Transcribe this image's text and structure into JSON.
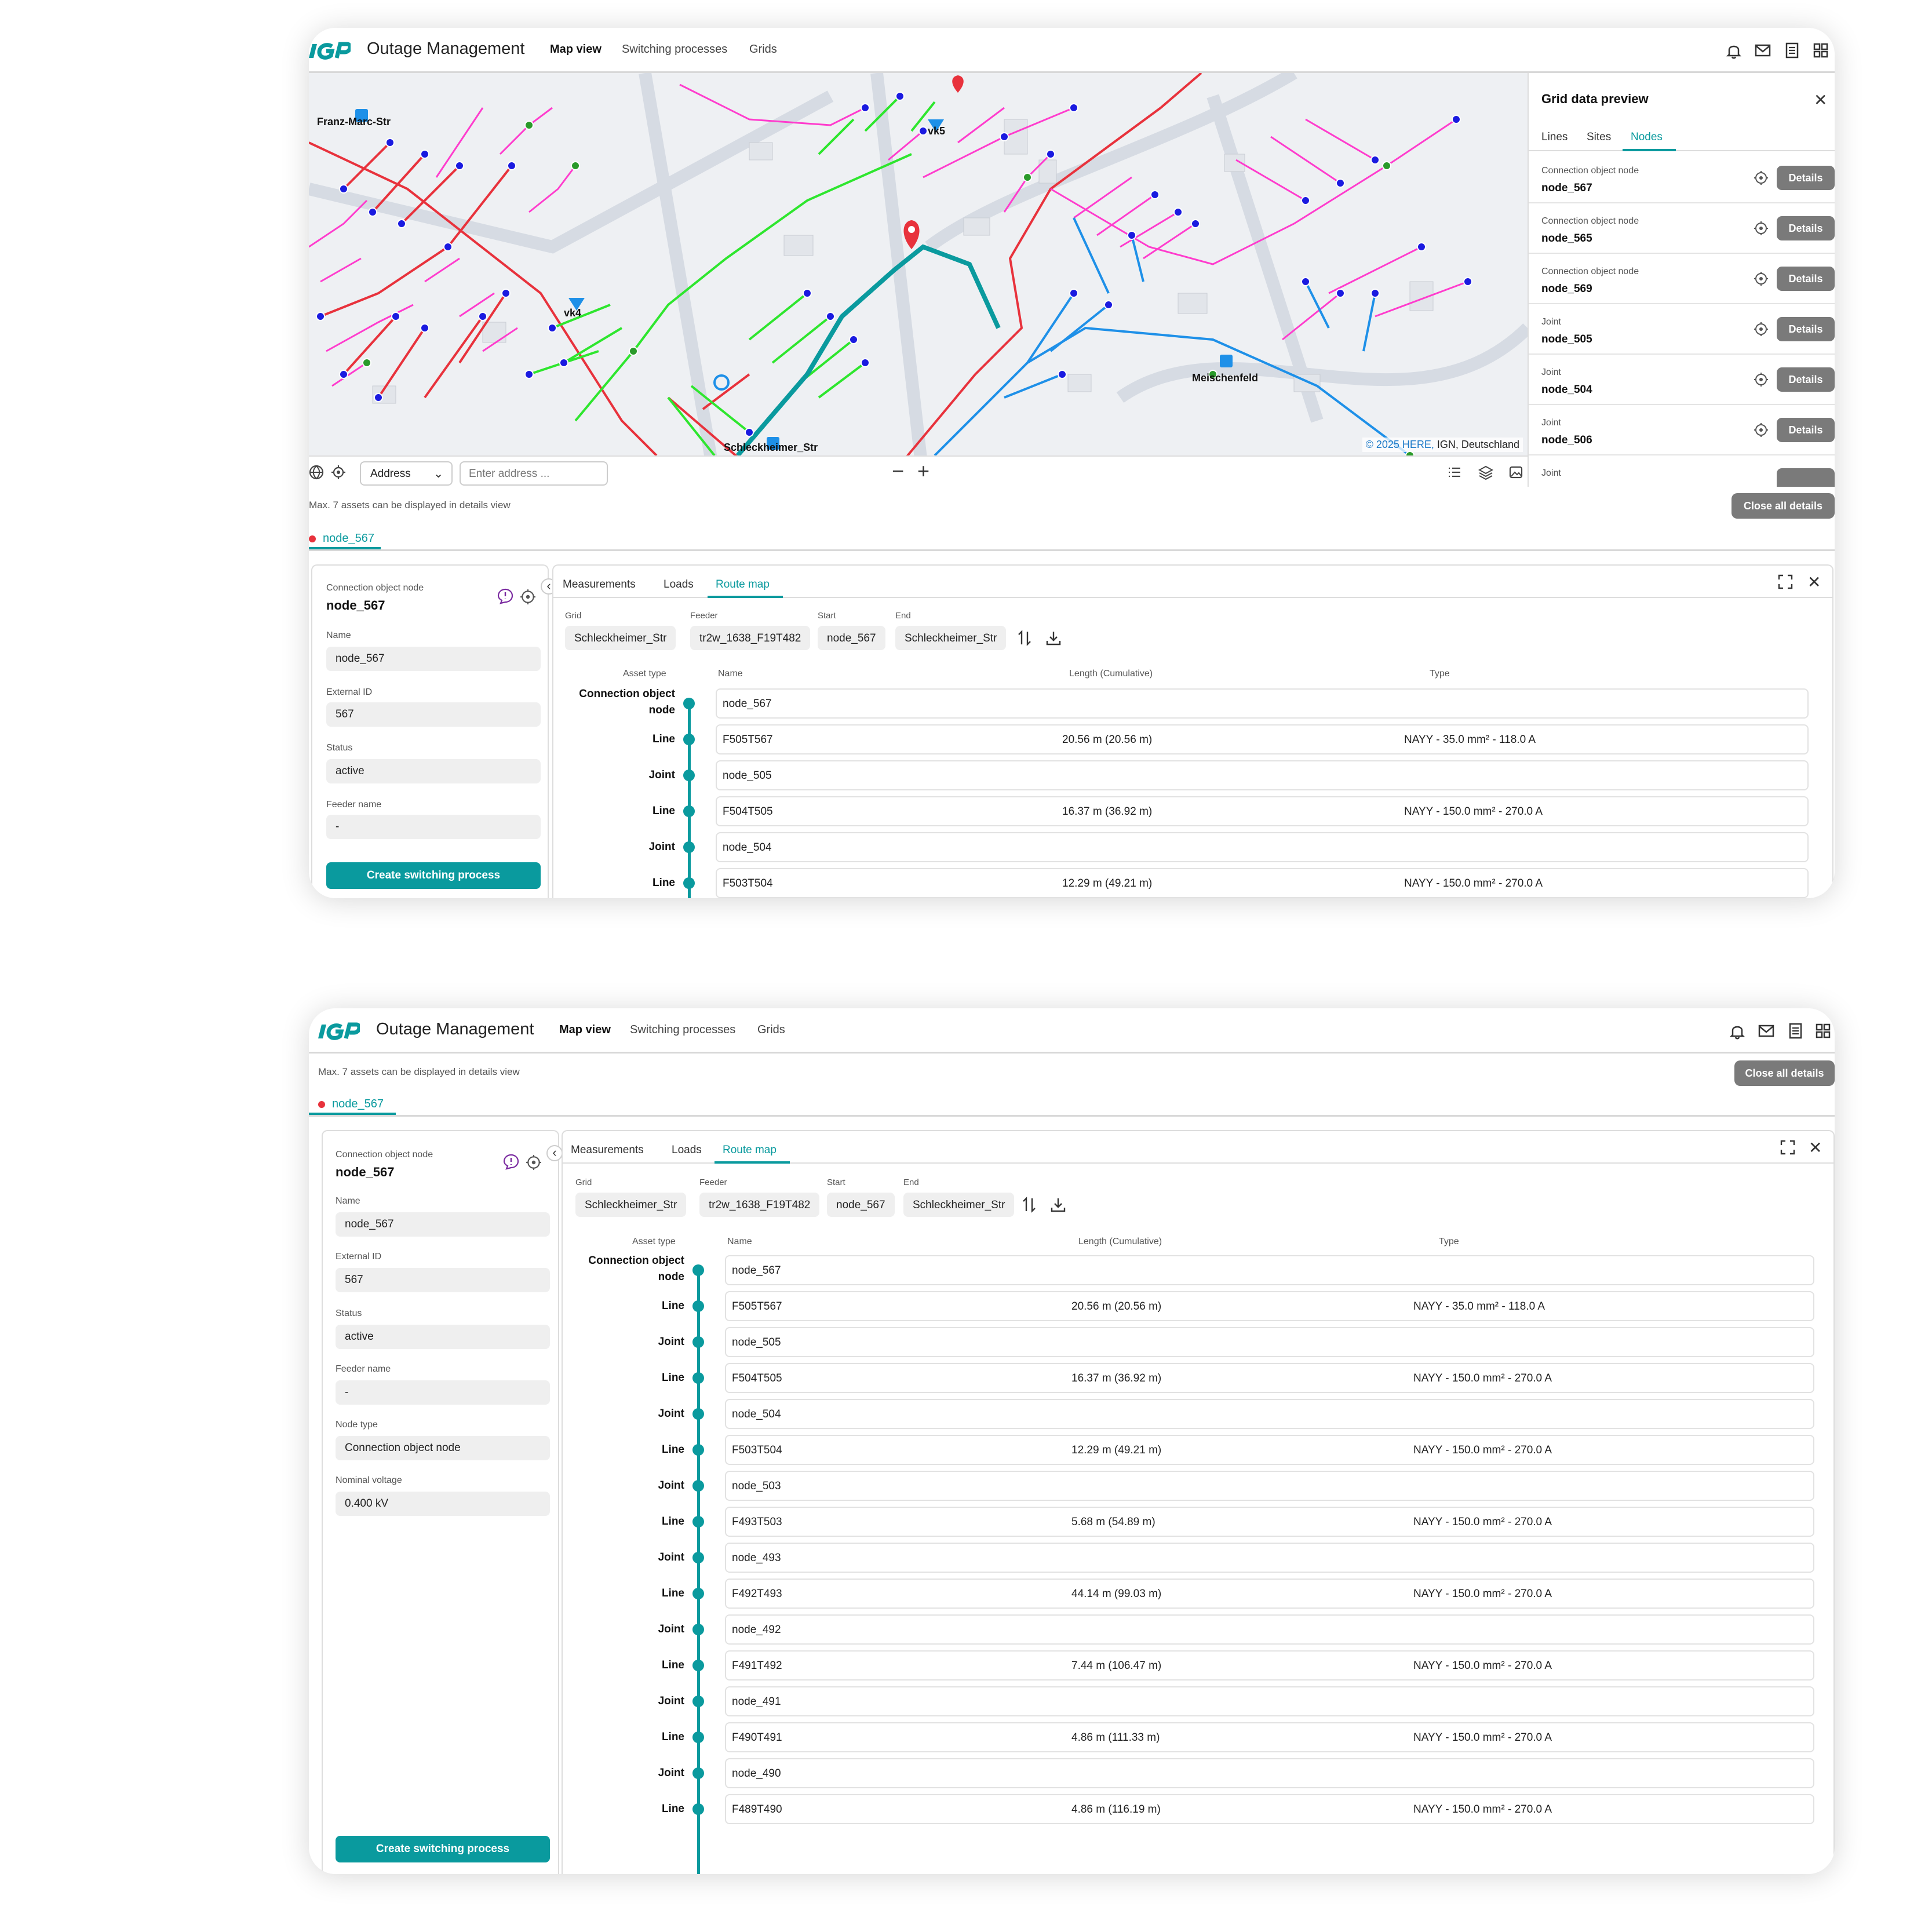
{
  "app": {
    "logo_text": "IGP",
    "title": "Outage Management",
    "nav": [
      {
        "label": "Map view",
        "active": true
      },
      {
        "label": "Switching processes",
        "active": false
      },
      {
        "label": "Grids",
        "active": false
      }
    ],
    "header_icons": [
      "bell-icon",
      "mail-icon",
      "document-icon",
      "apps-grid-icon"
    ]
  },
  "map": {
    "labels": [
      "Franz-Marc-Str",
      "vk5",
      "vk4",
      "Meischenfeld",
      "Schleckheimer_Str"
    ],
    "attribution_brand": "© 2025 HERE,",
    "attribution_rest": " IGN, Deutschland",
    "toolbar": {
      "address_select": "Address",
      "address_placeholder": "Enter address ...",
      "zoom_out": "−",
      "zoom_in": "+"
    },
    "colors": {
      "red": "#e8323c",
      "pink": "#ff3ccd",
      "magenta": "#e8208a",
      "green": "#2ee62e",
      "blue": "#1e90e8",
      "teal_route": "#0a9a9e"
    }
  },
  "preview": {
    "title": "Grid data preview",
    "tabs": [
      {
        "label": "Lines",
        "active": false
      },
      {
        "label": "Sites",
        "active": false
      },
      {
        "label": "Nodes",
        "active": true
      }
    ],
    "details_label": "Details",
    "items": [
      {
        "type": "Connection object node",
        "name": "node_567"
      },
      {
        "type": "Connection object node",
        "name": "node_565"
      },
      {
        "type": "Connection object node",
        "name": "node_569"
      },
      {
        "type": "Joint",
        "name": "node_505"
      },
      {
        "type": "Joint",
        "name": "node_504"
      },
      {
        "type": "Joint",
        "name": "node_506"
      },
      {
        "type": "Joint",
        "name": ""
      }
    ]
  },
  "details_view": {
    "max_note": "Max. 7 assets can be displayed in details view",
    "close_all": "Close all details",
    "open_tab": "node_567",
    "node": {
      "type": "Connection object node",
      "title": "node_567",
      "fields": [
        {
          "label": "Name",
          "value": "node_567"
        },
        {
          "label": "External ID",
          "value": "567"
        },
        {
          "label": "Status",
          "value": "active"
        },
        {
          "label": "Feeder name",
          "value": "-"
        },
        {
          "label": "Node type",
          "value": "Connection object node"
        },
        {
          "label": "Nominal voltage",
          "value": "0.400 kV"
        }
      ],
      "create_button": "Create switching process"
    },
    "tabs": [
      {
        "label": "Measurements",
        "active": false
      },
      {
        "label": "Loads",
        "active": false
      },
      {
        "label": "Route map",
        "active": true
      }
    ],
    "filters": [
      {
        "label": "Grid",
        "value": "Schleckheimer_Str"
      },
      {
        "label": "Feeder",
        "value": "tr2w_1638_F19T482"
      },
      {
        "label": "Start",
        "value": "node_567"
      },
      {
        "label": "End",
        "value": "Schleckheimer_Str"
      }
    ],
    "columns": [
      "Asset type",
      "Name",
      "Length (Cumulative)",
      "Type"
    ],
    "route": [
      {
        "asset": "Connection object node",
        "name": "node_567",
        "length": "",
        "type": ""
      },
      {
        "asset": "Line",
        "name": "F505T567",
        "length": "20.56 m (20.56 m)",
        "type": "NAYY - 35.0 mm² - 118.0 A"
      },
      {
        "asset": "Joint",
        "name": "node_505",
        "length": "",
        "type": ""
      },
      {
        "asset": "Line",
        "name": "F504T505",
        "length": "16.37 m (36.92 m)",
        "type": "NAYY - 150.0 mm² - 270.0 A"
      },
      {
        "asset": "Joint",
        "name": "node_504",
        "length": "",
        "type": ""
      },
      {
        "asset": "Line",
        "name": "F503T504",
        "length": "12.29 m (49.21 m)",
        "type": "NAYY - 150.0 mm² - 270.0 A"
      },
      {
        "asset": "Joint",
        "name": "node_503",
        "length": "",
        "type": ""
      },
      {
        "asset": "Line",
        "name": "F493T503",
        "length": "5.68 m (54.89 m)",
        "type": "NAYY - 150.0 mm² - 270.0 A"
      },
      {
        "asset": "Joint",
        "name": "node_493",
        "length": "",
        "type": ""
      },
      {
        "asset": "Line",
        "name": "F492T493",
        "length": "44.14 m (99.03 m)",
        "type": "NAYY - 150.0 mm² - 270.0 A"
      },
      {
        "asset": "Joint",
        "name": "node_492",
        "length": "",
        "type": ""
      },
      {
        "asset": "Line",
        "name": "F491T492",
        "length": "7.44 m (106.47 m)",
        "type": "NAYY - 150.0 mm² - 270.0 A"
      },
      {
        "asset": "Joint",
        "name": "node_491",
        "length": "",
        "type": ""
      },
      {
        "asset": "Line",
        "name": "F490T491",
        "length": "4.86 m (111.33 m)",
        "type": "NAYY - 150.0 mm² - 270.0 A"
      },
      {
        "asset": "Joint",
        "name": "node_490",
        "length": "",
        "type": ""
      },
      {
        "asset": "Line",
        "name": "F489T490",
        "length": "4.86 m (116.19 m)",
        "type": "NAYY - 150.0 mm² - 270.0 A"
      }
    ]
  },
  "colors": {
    "accent": "#0a9a9e",
    "status_dot": "#e8323c",
    "button_gray": "#7a7a7a"
  }
}
